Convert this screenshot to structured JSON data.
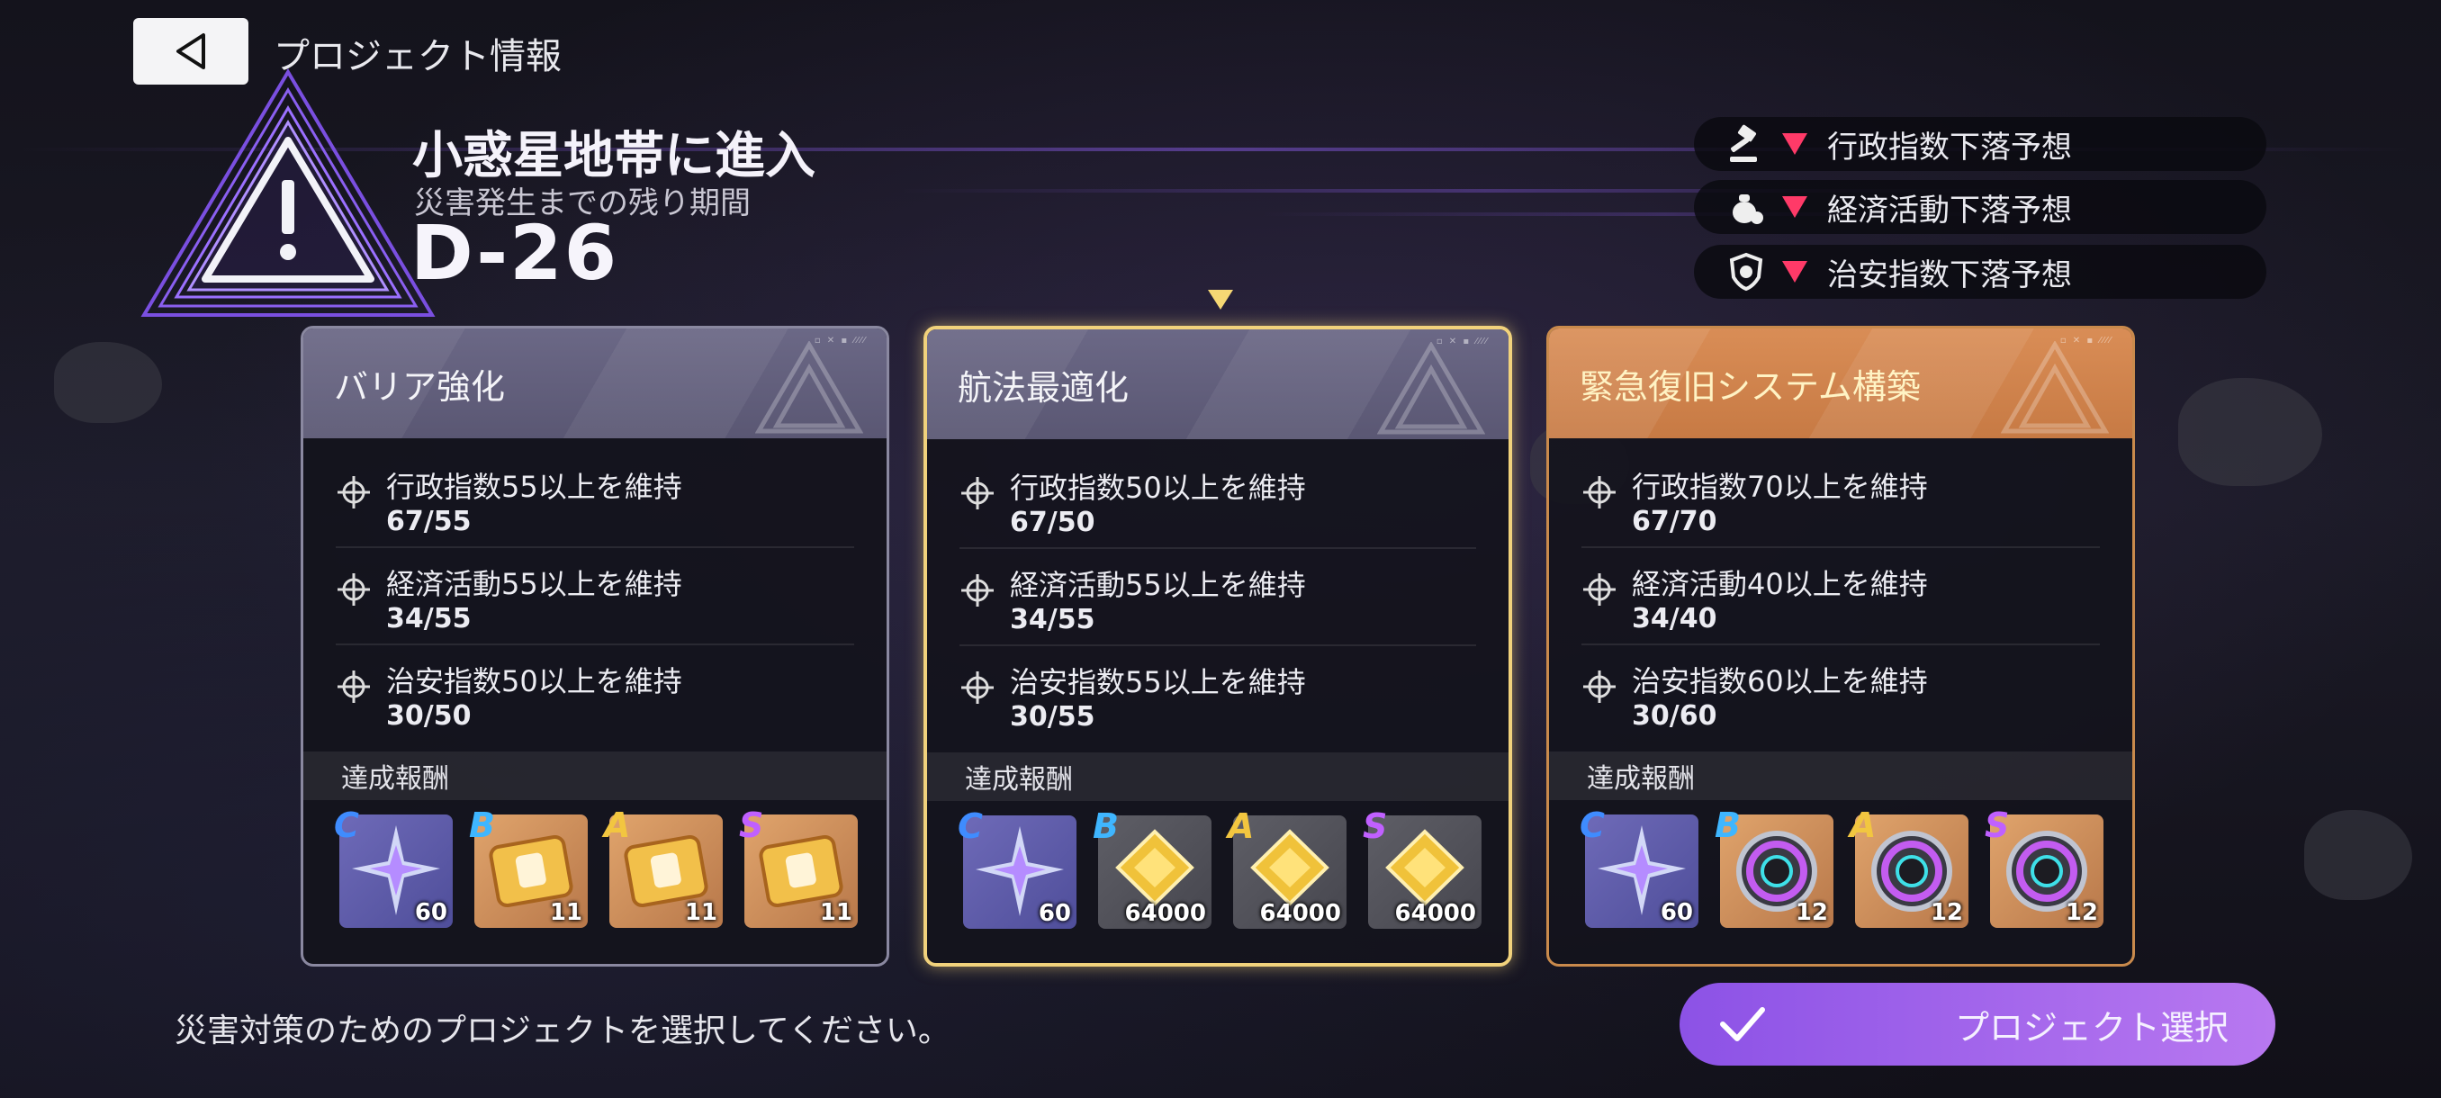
{
  "header": {
    "title": "プロジェクト情報"
  },
  "event": {
    "title": "小惑星地帯に進入",
    "subtitle": "災害発生までの残り期間",
    "countdown": "D-26"
  },
  "forecasts": [
    {
      "icon": "gavel-icon",
      "text": "行政指数下落予想"
    },
    {
      "icon": "money-bag-icon",
      "text": "経済活動下落予想"
    },
    {
      "icon": "police-badge-icon",
      "text": "治安指数下落予想"
    }
  ],
  "reward_label": "達成報酬",
  "projects": [
    {
      "title": "バリア強化",
      "conditions": [
        {
          "label": "行政指数55以上を維持",
          "value": "67/55"
        },
        {
          "label": "経済活動55以上を維持",
          "value": "34/55"
        },
        {
          "label": "治安指数50以上を維持",
          "value": "30/50"
        }
      ],
      "rewards": [
        {
          "grade": "C",
          "qty": "60",
          "item": "crystal-star-icon"
        },
        {
          "grade": "B",
          "qty": "11",
          "item": "gold-ticket-icon"
        },
        {
          "grade": "A",
          "qty": "11",
          "item": "gold-ticket-icon"
        },
        {
          "grade": "S",
          "qty": "11",
          "item": "gold-ticket-icon"
        }
      ]
    },
    {
      "title": "航法最適化",
      "conditions": [
        {
          "label": "行政指数50以上を維持",
          "value": "67/50"
        },
        {
          "label": "経済活動55以上を維持",
          "value": "34/55"
        },
        {
          "label": "治安指数55以上を維持",
          "value": "30/55"
        }
      ],
      "rewards": [
        {
          "grade": "C",
          "qty": "60",
          "item": "crystal-star-icon"
        },
        {
          "grade": "B",
          "qty": "64000",
          "item": "gold-chip-icon"
        },
        {
          "grade": "A",
          "qty": "64000",
          "item": "gold-chip-icon"
        },
        {
          "grade": "S",
          "qty": "64000",
          "item": "gold-chip-icon"
        }
      ]
    },
    {
      "title": "緊急復旧システム構築",
      "conditions": [
        {
          "label": "行政指数70以上を維持",
          "value": "67/70"
        },
        {
          "label": "経済活動40以上を維持",
          "value": "34/40"
        },
        {
          "label": "治安指数60以上を維持",
          "value": "30/60"
        }
      ],
      "rewards": [
        {
          "grade": "C",
          "qty": "60",
          "item": "crystal-star-icon"
        },
        {
          "grade": "B",
          "qty": "12",
          "item": "spiked-core-icon"
        },
        {
          "grade": "A",
          "qty": "12",
          "item": "spiked-core-icon"
        },
        {
          "grade": "S",
          "qty": "12",
          "item": "spiked-core-icon"
        }
      ]
    }
  ],
  "footer": {
    "instruction": "災害対策のためのプロジェクトを選択してください。",
    "confirm_label": "プロジェクト選択"
  },
  "colors": {
    "grade_c": "#3f8cff",
    "grade_b": "#3fb6ff",
    "grade_a": "#f2c640",
    "grade_s": "#c060ff",
    "down_arrow": "#ff3a68",
    "selected_border": "#f1d27c",
    "accent_button": "#9b62ea"
  }
}
